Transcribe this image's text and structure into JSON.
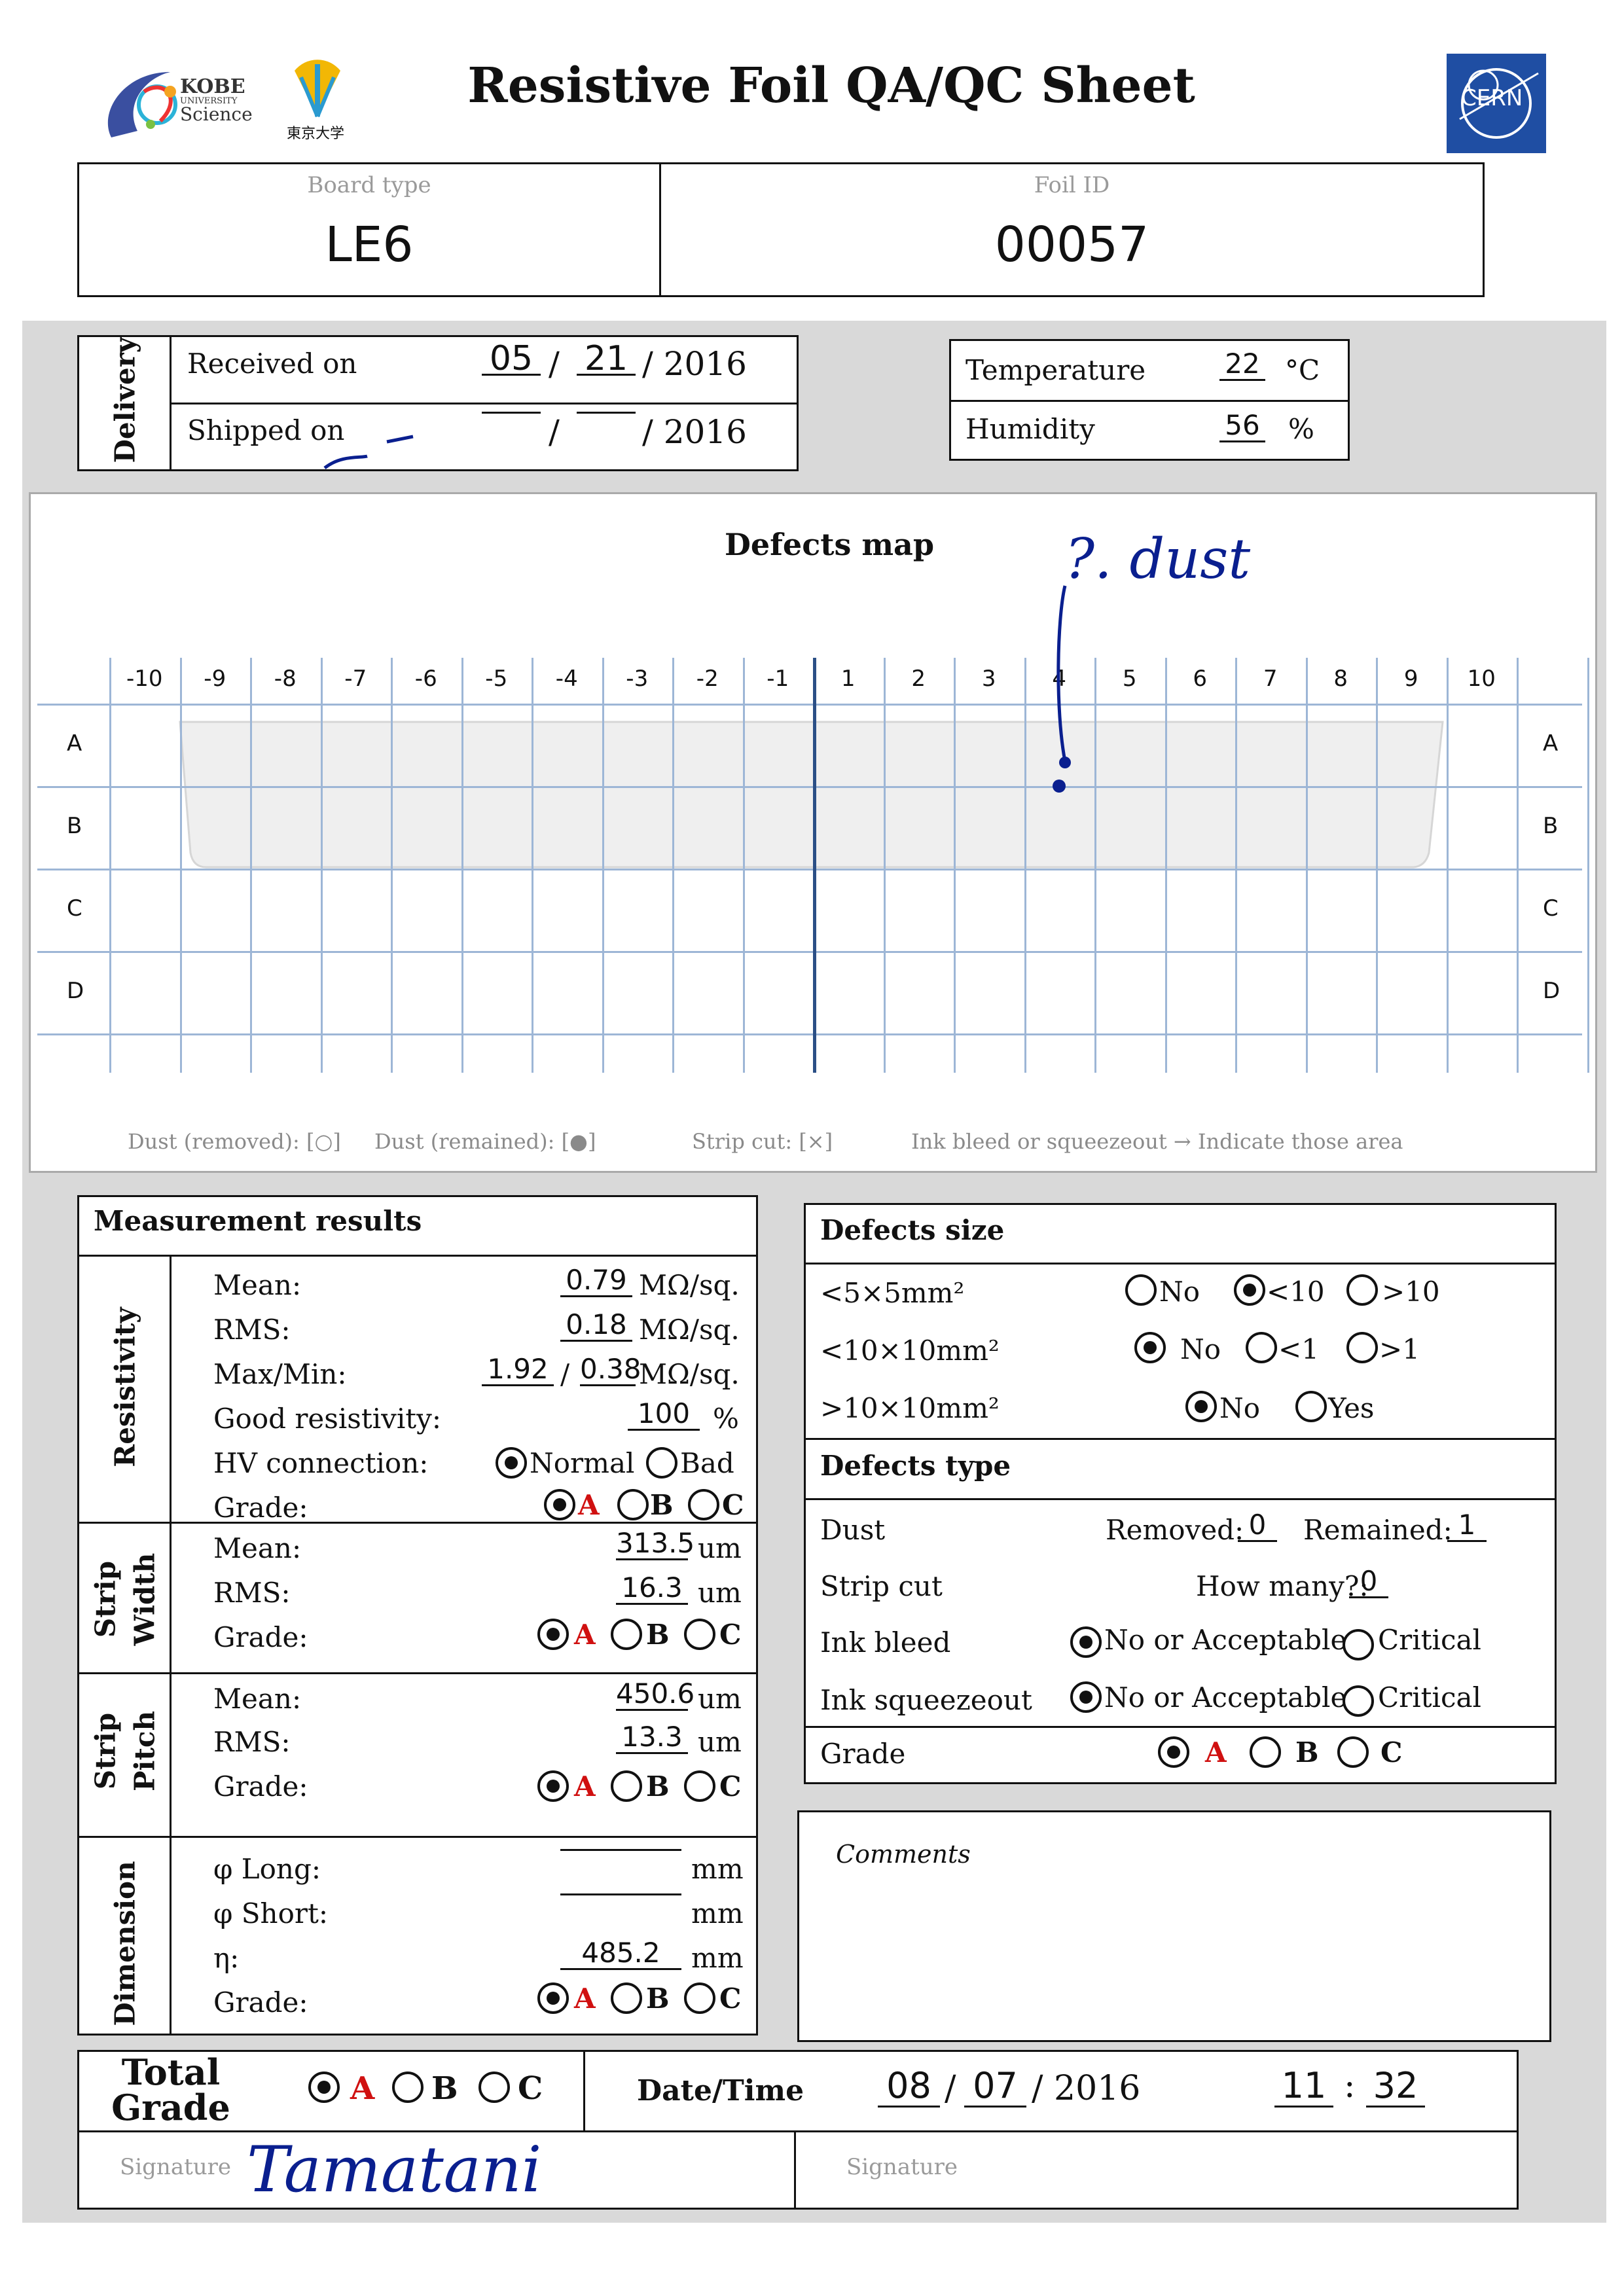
{
  "header": {
    "title": "Resistive Foil QA/QC Sheet",
    "kobe_logo_text": [
      "KOBE",
      "UNIVERSITY",
      "Science"
    ],
    "tokyo_logo_text": "東京大学",
    "cern_logo_text": "CERN"
  },
  "ids": {
    "board_type_label": "Board type",
    "board_type_value": "LE6",
    "foil_id_label": "Foil ID",
    "foil_id_value": "00057"
  },
  "delivery": {
    "section_label": "Delivery",
    "received_label": "Received on",
    "received_month": "05",
    "received_day": "21",
    "received_year": "/ 2016",
    "shipped_label": "Shipped on",
    "shipped_month": "",
    "shipped_day": "",
    "shipped_year": "/ 2016",
    "slash": "/"
  },
  "environment": {
    "temperature_label": "Temperature",
    "temperature_value": "22",
    "temperature_unit": "°C",
    "humidity_label": "Humidity",
    "humidity_value": "56",
    "humidity_unit": "%"
  },
  "defects_map": {
    "title": "Defects map",
    "columns": [
      "-10",
      "-9",
      "-8",
      "-7",
      "-6",
      "-5",
      "-4",
      "-3",
      "-2",
      "-1",
      "1",
      "2",
      "3",
      "4",
      "5",
      "6",
      "7",
      "8",
      "9",
      "10"
    ],
    "rows": [
      "A",
      "B",
      "C",
      "D"
    ],
    "handwritten_note": "?. dust",
    "legend": [
      "Dust (removed): [○]",
      "Dust (remained): [●]",
      "Strip cut: [×]",
      "Ink bleed or squeezeout → Indicate those area"
    ]
  },
  "measurement": {
    "title": "Measurement results",
    "resistivity": {
      "section_label": "Resistivity",
      "mean_label": "Mean:",
      "mean_value": "0.79",
      "mean_unit": "MΩ/sq.",
      "rms_label": "RMS:",
      "rms_value": "0.18",
      "rms_unit": "MΩ/sq.",
      "maxmin_label": "Max/Min:",
      "max_value": "1.92",
      "min_value": "0.38",
      "maxmin_unit": "MΩ/sq.",
      "good_label": "Good resistivity:",
      "good_value": "100",
      "good_unit": "%",
      "hv_label": "HV connection:",
      "hv_normal": "Normal",
      "hv_bad": "Bad",
      "grade_label": "Grade:"
    },
    "strip_width": {
      "section_label": [
        "Strip",
        "Width"
      ],
      "mean_label": "Mean:",
      "mean_value": "313.5",
      "mean_unit": "um",
      "rms_label": "RMS:",
      "rms_value": "16.3",
      "rms_unit": "um",
      "grade_label": "Grade:"
    },
    "strip_pitch": {
      "section_label": [
        "Strip",
        "Pitch"
      ],
      "mean_label": "Mean:",
      "mean_value": "450.6",
      "mean_unit": "um",
      "rms_label": "RMS:",
      "rms_value": "13.3",
      "rms_unit": "um",
      "grade_label": "Grade:"
    },
    "dimension": {
      "section_label": "Dimension",
      "phi_long_label": "φ Long:",
      "phi_long_value": "",
      "phi_long_unit": "mm",
      "phi_short_label": "φ Short:",
      "phi_short_value": "",
      "phi_short_unit": "mm",
      "eta_label": "η:",
      "eta_value": "485.2",
      "eta_unit": "mm",
      "grade_label": "Grade:"
    },
    "grades": [
      "A",
      "B",
      "C"
    ]
  },
  "defects_size": {
    "title": "Defects size",
    "row1_label": "<5×5mm²",
    "row1_opts": [
      "No",
      "<10",
      ">10"
    ],
    "row2_label": "<10×10mm²",
    "row2_opts": [
      "No",
      "<1",
      ">1"
    ],
    "row3_label": ">10×10mm²",
    "row3_opts": [
      "No",
      "Yes"
    ]
  },
  "defects_type": {
    "title": "Defects type",
    "dust_label": "Dust",
    "removed_label": "Removed:",
    "removed_value": "0",
    "remained_label": "Remained:",
    "remained_value": "1",
    "strip_cut_label": "Strip cut",
    "how_many_label": "How many?:",
    "how_many_value": "0",
    "ink_bleed_label": "Ink bleed",
    "ink_squeeze_label": "Ink squeezeout",
    "acceptable": "No or Acceptable",
    "critical": "Critical",
    "grade_label": "Grade"
  },
  "comments": {
    "label": "Comments",
    "text": ""
  },
  "total": {
    "label_line1": "Total",
    "label_line2": "Grade",
    "datetime_label": "Date/Time",
    "month": "08",
    "day": "07",
    "year": "/ 2016",
    "hour": "11",
    "minute": "32",
    "colon": ":",
    "slash": "/",
    "signature_label": "Signature",
    "signature_value": "Tamatani",
    "signature2_label": "Signature"
  }
}
